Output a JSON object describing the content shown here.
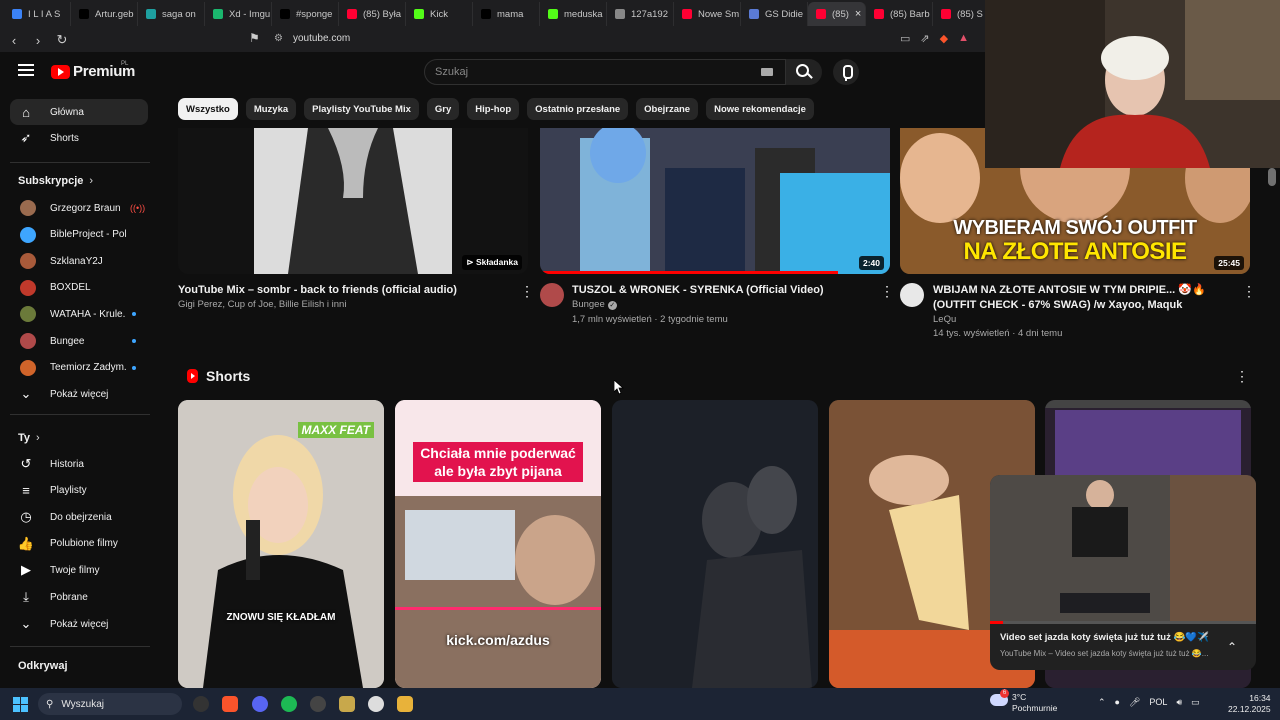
{
  "browser": {
    "tabs": [
      {
        "label": "I L I A S",
        "color": "#3b82f6"
      },
      {
        "label": "Artur.geb",
        "color": "#000000"
      },
      {
        "label": "saga on",
        "color": "#1ea0a0"
      },
      {
        "label": "Xd - Imgu",
        "color": "#1bb76e"
      },
      {
        "label": "#sponge",
        "color": "#000000"
      },
      {
        "label": "(85) Była",
        "color": "#ff0033"
      },
      {
        "label": "Kick",
        "color": "#53fc18"
      },
      {
        "label": "mama",
        "color": "#000000"
      },
      {
        "label": "meduska",
        "color": "#53fc18"
      },
      {
        "label": "127a192",
        "color": "#888888"
      },
      {
        "label": "Nowe Sm",
        "color": "#ff0033"
      },
      {
        "label": "GS Didie",
        "color": "#5b7bd5"
      },
      {
        "label": "(85)",
        "color": "#ff0033",
        "active": true,
        "close": "×"
      },
      {
        "label": "(85) Barb",
        "color": "#ff0033"
      },
      {
        "label": "(85) S",
        "color": "#ff0033"
      }
    ],
    "url": "youtube.com"
  },
  "youtube": {
    "logo_text": "Premium",
    "logo_region": "PL",
    "search_placeholder": "Szukaj"
  },
  "sidebar": {
    "main": [
      {
        "label": "Główna",
        "icon": "home-icon",
        "glyph": "⌂",
        "active": true
      },
      {
        "label": "Shorts",
        "icon": "shorts-icon",
        "glyph": "➶"
      }
    ],
    "subscriptions_heading": "Subskrypcje",
    "subscriptions": [
      {
        "label": "Grzegorz Braun",
        "color": "#9a6b4f",
        "status": "live"
      },
      {
        "label": "BibleProject - Polski",
        "color": "#3ea6ff",
        "status": ""
      },
      {
        "label": "SzklanaY2J",
        "color": "#a85a3a",
        "status": ""
      },
      {
        "label": "BOXDEL",
        "color": "#c0392b",
        "status": ""
      },
      {
        "label": "WATAHA - Krule...",
        "color": "#6b7a3a",
        "status": "dot"
      },
      {
        "label": "Bungee",
        "color": "#b04a4a",
        "status": "dot"
      },
      {
        "label": "Teemiorz Zadym...",
        "color": "#d0642a",
        "status": "dot"
      }
    ],
    "show_more_1": "Pokaż więcej",
    "you_heading": "Ty",
    "you_items": [
      {
        "label": "Historia",
        "icon": "history-icon",
        "glyph": "↺"
      },
      {
        "label": "Playlisty",
        "icon": "playlists-icon",
        "glyph": "≡"
      },
      {
        "label": "Do obejrzenia",
        "icon": "watch-later-icon",
        "glyph": "◷"
      },
      {
        "label": "Polubione filmy",
        "icon": "like-icon",
        "glyph": "👍"
      },
      {
        "label": "Twoje filmy",
        "icon": "your-videos-icon",
        "glyph": "▶"
      },
      {
        "label": "Pobrane",
        "icon": "download-icon",
        "glyph": "⤓"
      }
    ],
    "show_more_2": "Pokaż więcej",
    "explore_heading": "Odkrywaj"
  },
  "chips": [
    "Wszystko",
    "Muzyka",
    "Playlisty YouTube Mix",
    "Gry",
    "Hip-hop",
    "Ostatnio przesłane",
    "Obejrzane",
    "Nowe rekomendacje"
  ],
  "videos": [
    {
      "title": "YouTube Mix – sombr - back to friends (official audio)",
      "channel": "Gigi Perez, Cup of Joe, Billie Eilish i inni",
      "stats": "",
      "badge": "Składanka"
    },
    {
      "title": "TUSZOL & WRONEK - SYRENKA (Official Video)",
      "channel": "Bungee",
      "stats": "1,7 mln wyświetleń · 2 tygodnie temu",
      "badge": "2:40",
      "progress": 0.85
    },
    {
      "title": "WBIJAM NA ZŁOTE ANTOSIE W TYM DRIPIE... 🤡🔥 (OUTFIT CHECK - 67% SWAG) /w Xayoo, Maquk",
      "channel": "LeQu",
      "stats": "14 tys. wyświetleń · 4 dni temu",
      "badge": "25:45",
      "overlay_line1": "WYBIERAM SWÓJ OUTFIT",
      "overlay_line2": "NA ZŁOTE ANTOSIE"
    }
  ],
  "shorts": {
    "heading": "Shorts",
    "items": [
      {
        "caption": "ZNOWU SIĘ KŁADŁAM",
        "top_text": "MAXX FEAT"
      },
      {
        "caption": "kick.com/azdus",
        "top_text": "Chciała mnie poderwać ale była zbyt pijana"
      },
      {
        "caption": "",
        "top_text": ""
      },
      {
        "caption": "",
        "top_text": ""
      },
      {
        "caption": "",
        "top_text": ""
      }
    ]
  },
  "miniplayer": {
    "title": "Video set jazda koty święta już tuż tuż 😂💙✈️",
    "subtitle": "YouTube Mix – Video set jazda koty święta już tuż tuż 😂...",
    "progress": 0.05
  },
  "taskbar": {
    "search_label": "Wyszukaj",
    "weather_temp": "3°C",
    "weather_desc": "Pochmurnie",
    "weather_badge": "6",
    "language": "POL",
    "time": "16:34",
    "date": "22.12.2025"
  }
}
